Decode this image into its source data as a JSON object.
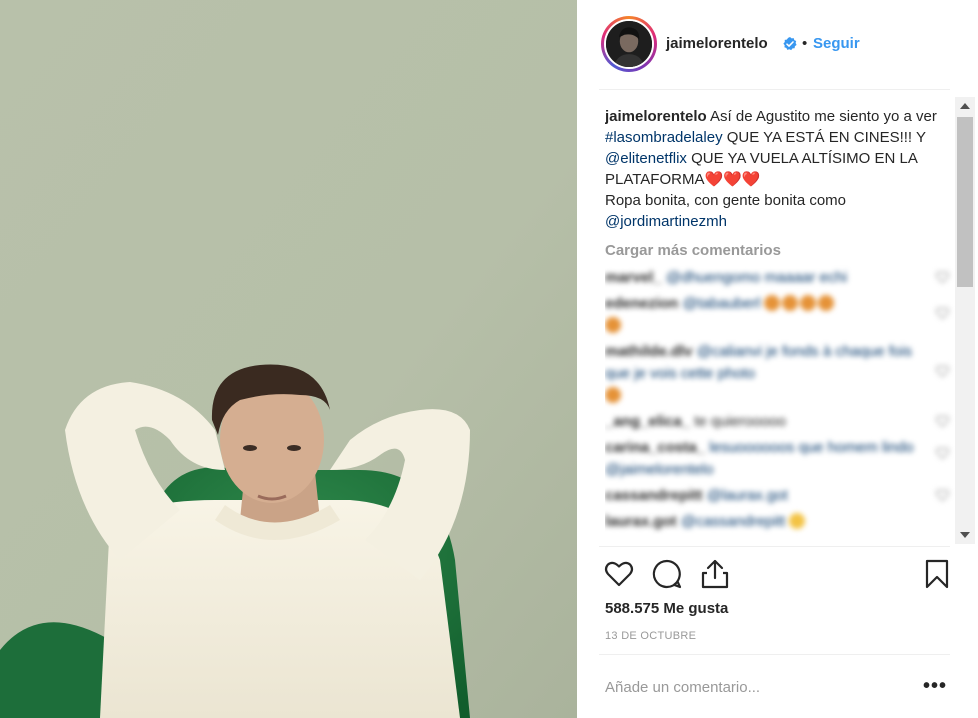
{
  "post": {
    "username": "jaimelorentelo",
    "dot": "•",
    "follow_label": "Seguir",
    "caption": {
      "text1": " Así de Agustito me siento yo a ver ",
      "hashtag": "#lasombradelaley",
      "text2": " QUE YA ESTÁ EN CINES!!! Y ",
      "mention1": "@elitenetflix",
      "text3": " QUE YA VUELA ALTÍSIMO EN LA PLATAFORMA",
      "hearts": "❤️❤️❤️",
      "text4": " Ropa bonita, con gente bonita como ",
      "mention2": "@jordimartinezmh"
    },
    "load_more_label": "Cargar más comentarios",
    "comments": [
      {
        "user": "marvel_",
        "text": "@dhuengomo maaaar echi"
      },
      {
        "user": "edenezion",
        "text": "@tabauberl"
      },
      {
        "user": "mathilde.dlv",
        "text": "@calianvi je fonds à chaque fois que je vois cette photo"
      },
      {
        "user": "_ang_elica_",
        "text": "te quierooooo"
      },
      {
        "user": "carina_costa_",
        "text": "lesuoooooos que homem lindo @jaimelorentelo"
      },
      {
        "user": "cassandrepitt",
        "text": "@laurax.got"
      },
      {
        "user": "laurax.got",
        "text": "@cassandrepitt"
      }
    ],
    "likes_text": "588.575 Me gusta",
    "date": "13 DE OCTUBRE",
    "add_comment_placeholder": "Añade un comentario...",
    "more_label": "•••"
  },
  "colors": {
    "link": "#003569",
    "follow": "#3897f0",
    "heart_red": "#e0161c",
    "verified": "#3897f0",
    "muted": "#999999"
  },
  "icons": {
    "like": "heart-outline-icon",
    "comment": "speech-bubble-icon",
    "share": "share-upload-icon",
    "save": "bookmark-icon",
    "verified": "verified-badge-icon"
  }
}
